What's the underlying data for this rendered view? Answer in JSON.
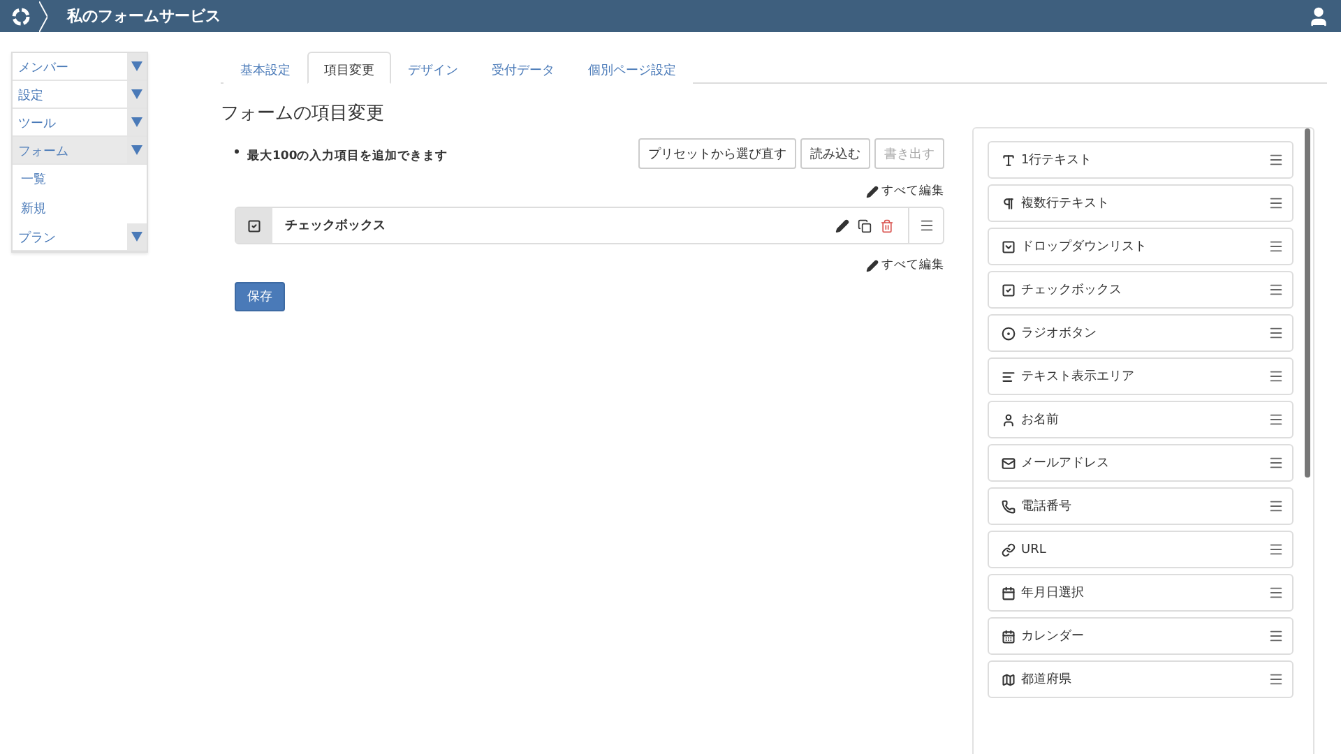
{
  "header": {
    "title": "私のフォームサービス"
  },
  "sidebar": {
    "items": [
      {
        "label": "メンバー",
        "expanded": false
      },
      {
        "label": "設定",
        "expanded": false
      },
      {
        "label": "ツール",
        "expanded": false
      },
      {
        "label": "フォーム",
        "expanded": true,
        "children": [
          {
            "label": "一覧"
          },
          {
            "label": "新規"
          }
        ]
      },
      {
        "label": "プラン",
        "expanded": false
      }
    ]
  },
  "tabs": [
    {
      "label": "基本設定",
      "selected": false
    },
    {
      "label": "項目変更",
      "selected": true
    },
    {
      "label": "デザイン",
      "selected": false
    },
    {
      "label": "受付データ",
      "selected": false
    },
    {
      "label": "個別ページ設定",
      "selected": false
    }
  ],
  "page_title": "フォームの項目変更",
  "note": "最大100の入力項目を追加できます",
  "buttons": [
    {
      "label": "プリセットから選び直す",
      "disabled": false
    },
    {
      "label": "読み込む",
      "disabled": false
    },
    {
      "label": "書き出す",
      "disabled": true
    }
  ],
  "edit_all": [
    "すべて編集",
    "すべて編集"
  ],
  "form_items": [
    {
      "kind": "checkbox",
      "label": "チェックボックス"
    }
  ],
  "save_button": "保存",
  "palette": [
    {
      "kind": "text",
      "label": "1行テキスト"
    },
    {
      "kind": "textarea",
      "label": "複数行テキスト"
    },
    {
      "kind": "dropdown",
      "label": "ドロップダウンリスト"
    },
    {
      "kind": "checkbox",
      "label": "チェックボックス"
    },
    {
      "kind": "radio",
      "label": "ラジオボタン"
    },
    {
      "kind": "display",
      "label": "テキスト表示エリア"
    },
    {
      "kind": "name",
      "label": "お名前"
    },
    {
      "kind": "email",
      "label": "メールアドレス"
    },
    {
      "kind": "phone",
      "label": "電話番号"
    },
    {
      "kind": "url",
      "label": "URL"
    },
    {
      "kind": "date",
      "label": "年月日選択"
    },
    {
      "kind": "calendar",
      "label": "カレンダー"
    },
    {
      "kind": "prefecture",
      "label": "都道府県"
    }
  ]
}
